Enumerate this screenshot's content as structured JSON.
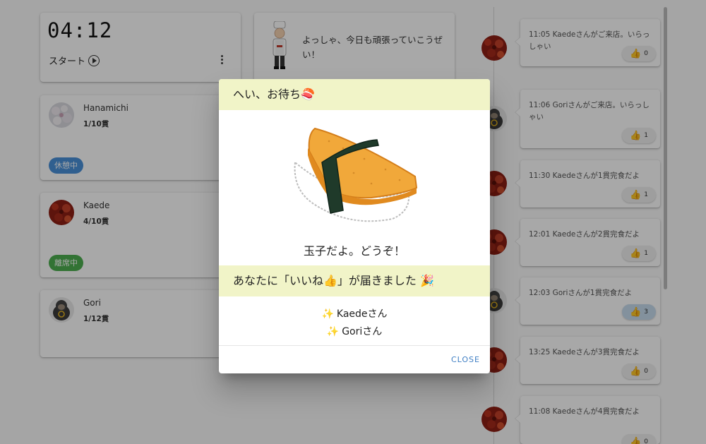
{
  "timer": {
    "value": "04:12",
    "start_label": "スタート"
  },
  "chef": {
    "message": "よっしゃ、今日も頑張っていこうぜい！"
  },
  "users": [
    {
      "name": "Hanamichi",
      "count": "1/10貫",
      "status": "休憩中",
      "status_color": "#4a90d9"
    },
    {
      "name": "Kaede",
      "count": "4/10貫",
      "status": "離席中",
      "status_color": "#4caf50"
    },
    {
      "name": "Gori",
      "count": "1/12貫",
      "status": ""
    }
  ],
  "timeline": [
    {
      "text": "11:05 Kaedeさんがご来店。いらっしゃい",
      "likes": "0",
      "avatar": "kaede"
    },
    {
      "text": "11:06 Goriさんがご来店。いらっしゃい",
      "likes": "1",
      "avatar": "gori"
    },
    {
      "text": "11:30 Kaedeさんが1貫完食だよ",
      "likes": "1",
      "avatar": "kaede"
    },
    {
      "text": "12:01 Kaedeさんが2貫完食だよ",
      "likes": "1",
      "avatar": "kaede"
    },
    {
      "text": "12:03 Goriさんが1貫完食だよ",
      "likes": "3",
      "avatar": "gori",
      "active": true
    },
    {
      "text": "13:25 Kaedeさんが3貫完食だよ",
      "likes": "0",
      "avatar": "kaede"
    },
    {
      "text": "11:08 Kaedeさんが4貫完食だよ",
      "likes": "0",
      "avatar": "kaede"
    }
  ],
  "dialog": {
    "title": "へい、お待ち🍣",
    "sushi_name": "玉子だよ。どうぞ！",
    "likes_title": "あなたに「いいね👍」が届きました 🎉",
    "likers": [
      "Kaedeさん",
      "Goriさん"
    ],
    "sparkle": "✨",
    "close_label": "CLOSE"
  },
  "icons": {
    "like": "👍",
    "sparkle": "✨"
  }
}
